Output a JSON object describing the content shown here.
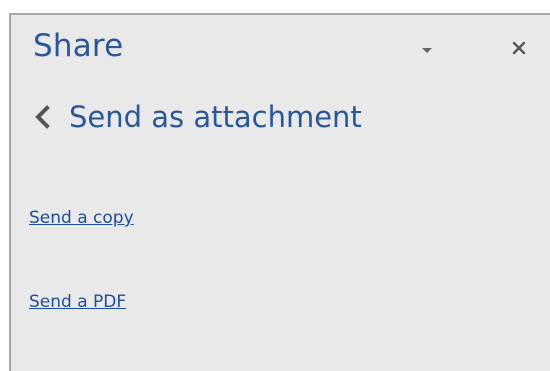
{
  "pane": {
    "title": "Share",
    "dropdown_icon": "caret-down-icon",
    "close_icon": "close-icon",
    "back_icon": "chevron-left-icon",
    "subtitle": "Send as attachment"
  },
  "links": {
    "send_copy": "Send a copy",
    "send_pdf": "Send a PDF"
  },
  "colors": {
    "pane_background": "#e9e9e9",
    "title": "#2b5797",
    "link": "#1f4e99",
    "icon": "#666666"
  }
}
